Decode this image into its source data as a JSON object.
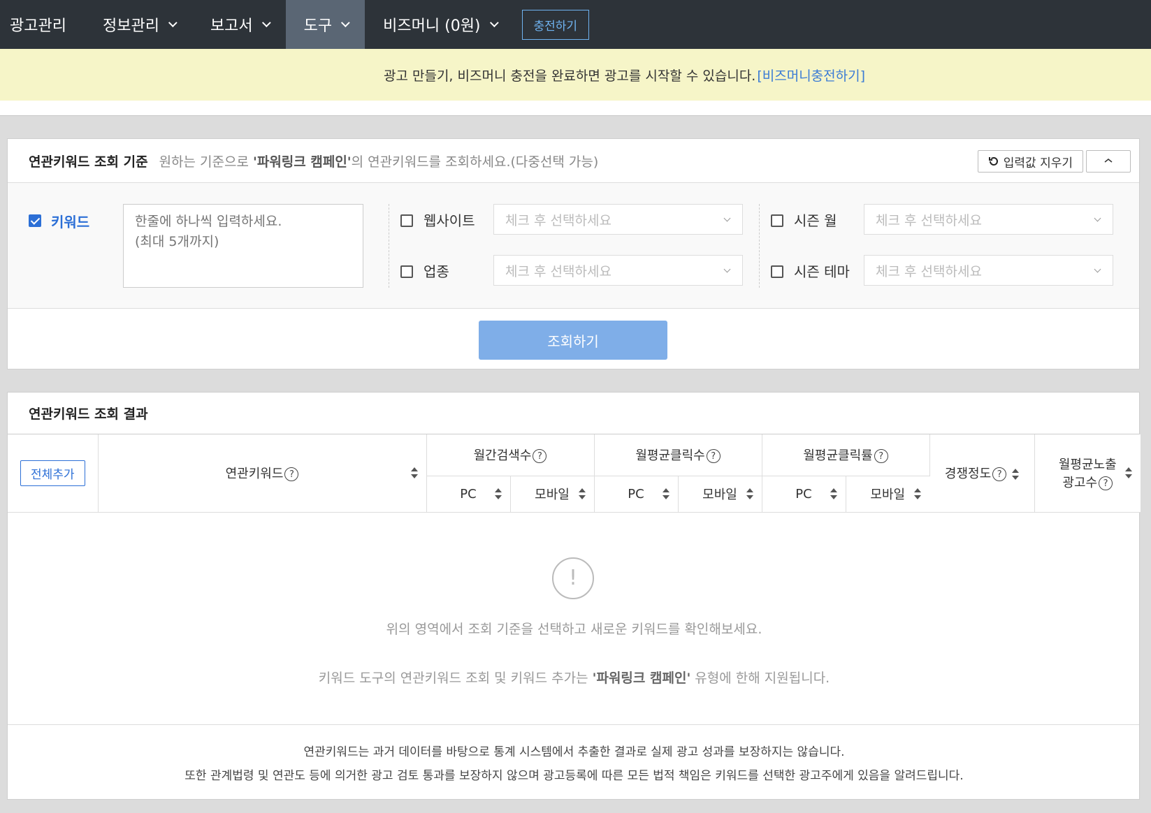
{
  "nav": {
    "items": [
      {
        "label": "광고관리",
        "has_chevron": false
      },
      {
        "label": "정보관리",
        "has_chevron": true
      },
      {
        "label": "보고서",
        "has_chevron": true
      },
      {
        "label": "도구",
        "has_chevron": true,
        "active": true
      },
      {
        "label": "비즈머니 (0원)",
        "has_chevron": true
      }
    ],
    "charge_button": "충전하기"
  },
  "notice": {
    "text": "광고 만들기, 비즈머니 충전을 완료하면 광고를 시작할 수 있습니다.",
    "link": "[비즈머니충전하기]"
  },
  "criteria": {
    "title": "연관키워드 조회 기준",
    "desc_prefix": "원하는 기준으로 ",
    "desc_bold": "'파워링크 캠페인'",
    "desc_suffix": "의 연관키워드를 조회하세요.(다중선택 가능)",
    "reset_button": "입력값 지우기",
    "collapse_icon": "chevron-up-icon",
    "keyword": {
      "label": "키워드",
      "checked": true,
      "placeholder": "한줄에 하나씩 입력하세요.\n(최대 5개까지)"
    },
    "website": {
      "label": "웹사이트",
      "checked": false,
      "select_placeholder": "체크 후 선택하세요"
    },
    "industry": {
      "label": "업종",
      "checked": false,
      "select_placeholder": "체크 후 선택하세요"
    },
    "season_month": {
      "label": "시즌 월",
      "checked": false,
      "select_placeholder": "체크 후 선택하세요"
    },
    "season_theme": {
      "label": "시즌 테마",
      "checked": false,
      "select_placeholder": "체크 후 선택하세요"
    },
    "search_button": "조회하기",
    "accent_color": "#2c6fd6",
    "search_button_color": "#7faee8"
  },
  "results": {
    "title": "연관키워드 조회 결과",
    "add_all_button": "전체추가",
    "columns": {
      "keyword": "연관키워드",
      "monthly_search": "월간검색수",
      "avg_clicks": "월평균클릭수",
      "avg_ctr": "월평균클릭률",
      "competition": "경쟁정도",
      "avg_ads_line1": "월평균노출",
      "avg_ads_line2": "광고수",
      "pc": "PC",
      "mobile": "모바일"
    },
    "empty": {
      "icon": "exclamation-icon",
      "line1": "위의 영역에서 조회 기준을 선택하고 새로운 키워드를 확인해보세요.",
      "line2_prefix": "키워드 도구의 연관키워드 조회 및 키워드 추가는 ",
      "line2_bold": "'파워링크 캠페인'",
      "line2_suffix": " 유형에 한해 지원됩니다."
    },
    "disclaimer": {
      "line1": "연관키워드는 과거 데이터를 바탕으로 통계 시스템에서 추출한 결과로 실제 광고 성과를 보장하지는 않습니다.",
      "line2": "또한 관계법령 및 연관도 등에 의거한 광고 검토 통과를 보장하지 않으며 광고등록에 따른 모든 법적 책임은 키워드를 선택한 광고주에게 있음을 알려드립니다."
    }
  }
}
